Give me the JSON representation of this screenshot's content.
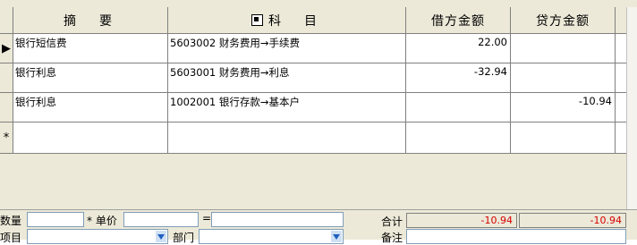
{
  "grid": {
    "columns": [
      "摘　要",
      "科　目",
      "借方金额",
      "贷方金额"
    ],
    "rows": [
      {
        "summary": "银行短信费",
        "account": "5603002 财务费用→手续费",
        "debit": "22.00",
        "credit": ""
      },
      {
        "summary": "银行利息",
        "account": "5603001 财务费用→利息",
        "debit": "-32.94",
        "credit": ""
      },
      {
        "summary": "银行利息",
        "account": "1002001 银行存款→基本户",
        "debit": "",
        "credit": "-10.94"
      }
    ],
    "new_row_marker": "*",
    "current_row_marker": "▶"
  },
  "footer": {
    "quantity_label": "数量",
    "unit_price_label": "* 单价",
    "equals_label": "=",
    "total_label": "合计",
    "total_debit": "-10.94",
    "total_credit": "-10.94",
    "project_label": "项目",
    "department_label": "部门",
    "note_label": "备注"
  },
  "colors": {
    "total_text": "#d40000",
    "panel_bg": "#ece9d8"
  }
}
